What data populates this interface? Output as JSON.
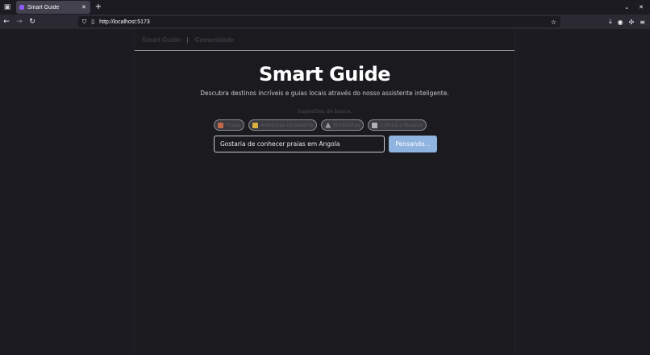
{
  "browser": {
    "tab_title": "Smart Guide",
    "url": "http://localhost:5173"
  },
  "nav": {
    "links": [
      "Smart Guide",
      "Comunidade"
    ],
    "separator": "|"
  },
  "hero": {
    "title": "Smart Guide",
    "subtitle": "Descubra destinos incríveis e guias locais através do nosso assistente inteligente."
  },
  "suggestions": {
    "label": "Sugestões de busca:",
    "chips": [
      {
        "label": "Praias",
        "icon": "umbrella-icon",
        "color": "#c06a4a"
      },
      {
        "label": "Aventuras no Deserto",
        "icon": "desert-icon",
        "color": "#d8b040"
      },
      {
        "label": "Montanhas",
        "icon": "mountain-icon",
        "color": "#9a9aa0"
      },
      {
        "label": "Cultura e Museus",
        "icon": "museum-icon",
        "color": "#b0b0b8"
      }
    ]
  },
  "search": {
    "value": "Gostaria de conhecer praias em Angola",
    "button_label": "Pensando..."
  },
  "colors": {
    "button": "#8fb4df",
    "page_bg": "#1c1b22"
  }
}
